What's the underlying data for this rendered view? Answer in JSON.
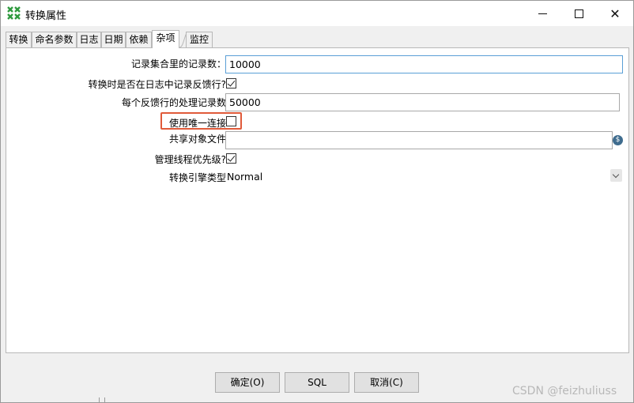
{
  "window": {
    "title": "转换属性",
    "minimize_icon": "minimize-icon",
    "maximize_icon": "maximize-icon",
    "close_icon": "close-icon",
    "close_glyph": "✕"
  },
  "tabs": [
    {
      "label": "转换"
    },
    {
      "label": "命名参数"
    },
    {
      "label": "日志"
    },
    {
      "label": "日期"
    },
    {
      "label": "依赖"
    },
    {
      "label": "杂项",
      "active": true
    },
    {
      "label": "监控"
    }
  ],
  "form": {
    "record_count_label": "记录集合里的记录数：",
    "record_count_value": "10000",
    "log_feedback_label": "转换时是否在日志中记录反馈行?",
    "log_feedback_checked": true,
    "feedback_size_label": "每个反馈行的处理记录数",
    "feedback_size_value": "50000",
    "unique_conn_label": "使用唯一连接",
    "unique_conn_checked": false,
    "shared_objects_label": "共享对象文件",
    "shared_objects_value": "",
    "variable_icon": "variable-icon",
    "variable_glyph": "$",
    "thread_priority_label": "管理线程优先级?",
    "thread_priority_checked": true,
    "engine_type_label": "转换引擎类型",
    "engine_type_value": "Normal"
  },
  "buttons": {
    "ok": "确定(O)",
    "sql": "SQL",
    "cancel": "取消(C)"
  },
  "watermark": "CSDN @feizhuliuss",
  "colors": {
    "highlight": "#e05a3a",
    "focus_border": "#5a9fd6"
  }
}
